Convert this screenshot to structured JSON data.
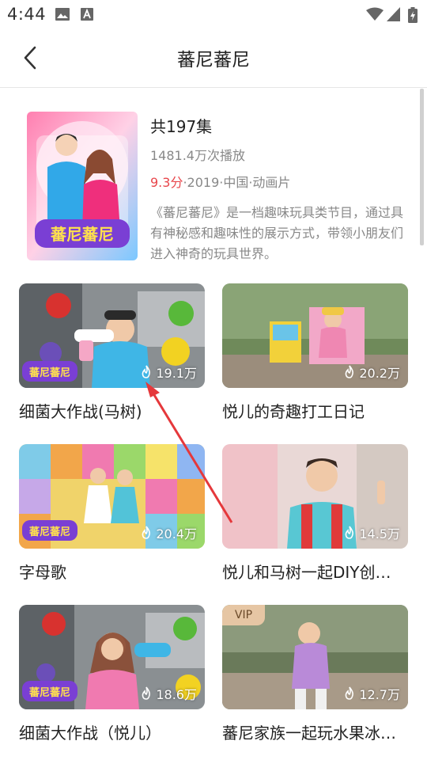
{
  "status_bar": {
    "time": "4:44"
  },
  "header": {
    "title": "蕃尼蕃尼"
  },
  "info": {
    "episodes": "共197集",
    "plays": "1481.4万次播放",
    "score": "9.3分",
    "meta": "·2019·中国·动画片",
    "description": "《蕃尼蕃尼》是一档趣味玩具类节目，通过具有神秘感和趣味性的展示方式，带领小朋友们进入神奇的玩具世界。",
    "poster_logo": "蕃尼蕃尼"
  },
  "videos": [
    {
      "title": "细菌大作战(马树)",
      "plays": "19.1万",
      "logo": "蕃尼蕃尼",
      "vip": false
    },
    {
      "title": "悦儿的奇趣打工日记",
      "plays": "20.2万",
      "vip": false
    },
    {
      "title": "字母歌",
      "plays": "20.4万",
      "logo": "蕃尼蕃尼",
      "vip": false
    },
    {
      "title": "悦儿和马树一起DIY创…",
      "plays": "14.5万",
      "vip": false
    },
    {
      "title": "细菌大作战（悦儿）",
      "plays": "18.6万",
      "logo": "蕃尼蕃尼",
      "vip": false
    },
    {
      "title": "蕃尼家族一起玩水果冰…",
      "plays": "12.7万",
      "vip": true,
      "vip_label": "VIP"
    }
  ],
  "colors": {
    "score": "#e8464b",
    "accent_arrow": "#e5383b"
  }
}
